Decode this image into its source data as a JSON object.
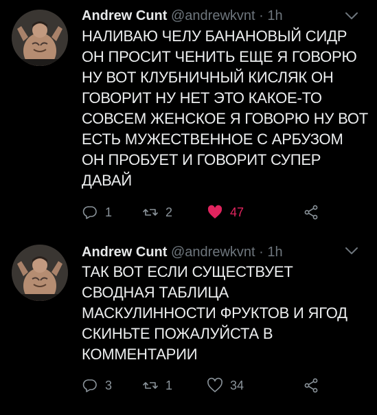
{
  "tweets": [
    {
      "author": "Andrew Cunt",
      "handle": "@andrewkvnt",
      "separator": "·",
      "time": "1h",
      "lines": [
        "НАЛИВАЮ ЧЕЛУ БАНАНОВЫЙ СИДР",
        "ОН ПРОСИТ ЧЕНИТЬ ЕЩЕ Я ГОВОРЮ",
        "НУ ВОТ КЛУБНИЧНЫЙ КИСЛЯК ОН",
        "ГОВОРИТ НУ НЕТ ЭТО КАКОЕ-ТО",
        "СОВСЕМ ЖЕНСКОЕ Я ГОВОРЮ НУ ВОТ",
        "ЕСТЬ МУЖЕСТВЕННОЕ С АРБУЗОМ",
        "ОН ПРОБУЕТ И ГОВОРИТ СУПЕР",
        "ДАВАЙ"
      ],
      "replies": "1",
      "retweets": "2",
      "likes": "47",
      "liked": true
    },
    {
      "author": "Andrew Cunt",
      "handle": "@andrewkvnt",
      "separator": "·",
      "time": "1h",
      "lines": [
        "ТАК ВОТ ЕСЛИ СУЩЕСТВУЕТ",
        "СВОДНАЯ ТАБЛИЦА",
        "МАСКУЛИННОСТИ ФРУКТОВ И ЯГОД",
        "СКИНЬТЕ ПОЖАЛУЙСТА В",
        "КОММЕНТАРИИ"
      ],
      "replies": "3",
      "retweets": "1",
      "likes": "34",
      "liked": false
    }
  ],
  "colors": {
    "background": "#000000",
    "text": "#eceeef",
    "meta": "#6e767d",
    "icon": "#8b949b",
    "like_active": "#e0245e"
  },
  "icons": {
    "reply": "reply-icon",
    "retweet": "retweet-icon",
    "like": "heart-icon",
    "share": "share-icon",
    "menu": "chevron-down-icon"
  }
}
